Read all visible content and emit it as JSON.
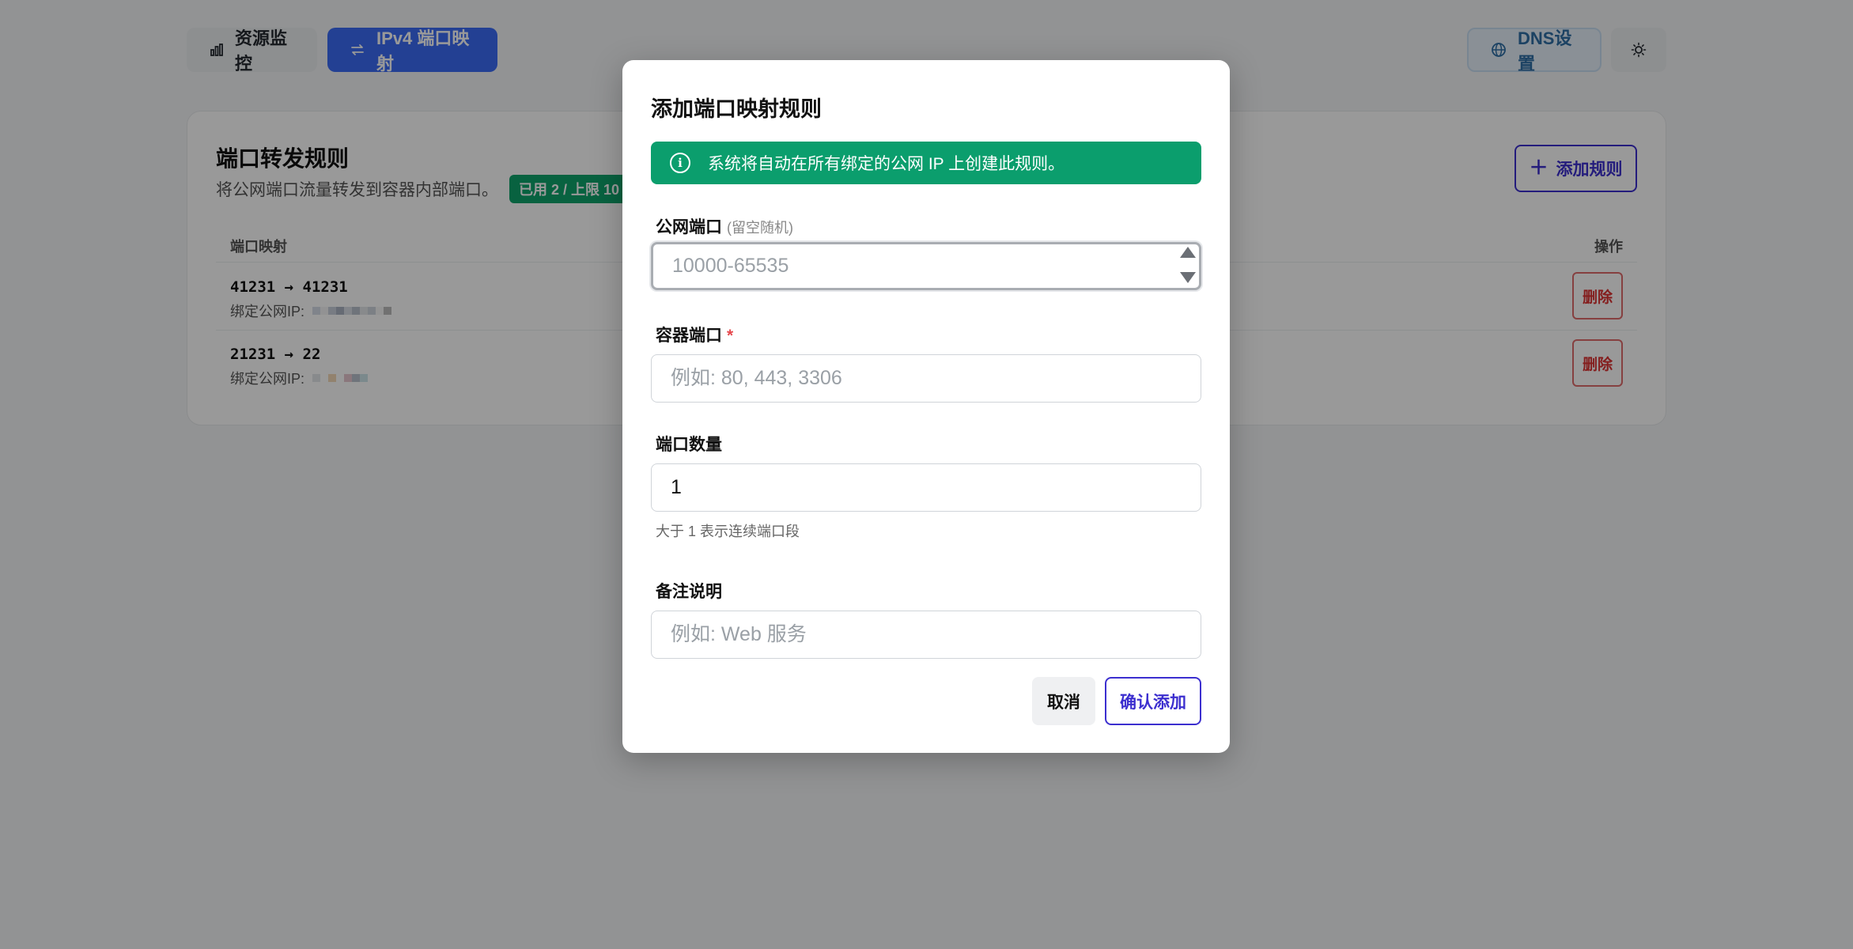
{
  "nav": {
    "monitor_label": "资源监控",
    "ipv4_label": "IPv4 端口映射",
    "dns_label": "DNS设置"
  },
  "card": {
    "title": "端口转发规则",
    "subtitle": "将公网端口流量转发到容器内部端口。",
    "quota_badge": "已用 2 / 上限 10",
    "add_rule_label": "添加规则",
    "col_mapping": "端口映射",
    "col_actions": "操作",
    "rules": [
      {
        "mapping": "41231 → 41231",
        "ip_label": "绑定公网IP:",
        "delete_label": "删除"
      },
      {
        "mapping": "21231 → 22",
        "ip_label": "绑定公网IP:",
        "delete_label": "删除"
      }
    ]
  },
  "modal": {
    "title": "添加端口映射规则",
    "info": "系统将自动在所有绑定的公网 IP 上创建此规则。",
    "public_port": {
      "label": "公网端口",
      "hint": "(留空随机)",
      "value": "",
      "placeholder": "10000-65535"
    },
    "container_port": {
      "label": "容器端口",
      "required_mark": "*",
      "value": "",
      "placeholder": "例如: 80, 443, 3306"
    },
    "port_count": {
      "label": "端口数量",
      "value": "1",
      "help": "大于 1 表示连续端口段"
    },
    "remark": {
      "label": "备注说明",
      "value": "",
      "placeholder": "例如: Web 服务"
    },
    "cancel_label": "取消",
    "confirm_label": "确认添加"
  },
  "colors": {
    "primary": "#3b6cf5",
    "accent": "#3c2fcf",
    "success": "#0b9e6d",
    "danger": "#d33333"
  }
}
